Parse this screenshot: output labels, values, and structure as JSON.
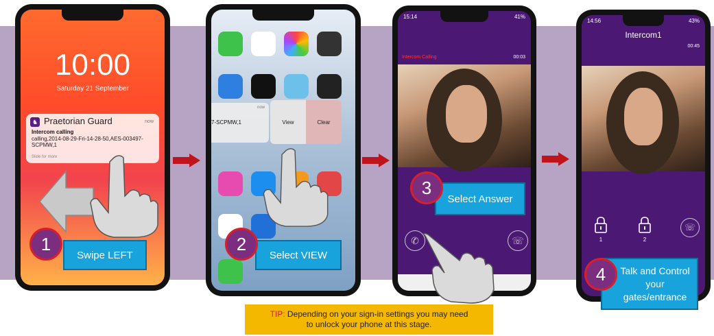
{
  "phone1": {
    "time": "10:00",
    "date": "Saturday 21 September",
    "notification": {
      "app": "Praetorian Guard",
      "when": "now",
      "title": "Intercom calling",
      "body": "calling,2014-08-29-Fri-14-28-50,AES-003497-SCPMW,1",
      "hint": "Slide for more"
    }
  },
  "phone2": {
    "when": "now",
    "fragment": "7-SCPMW,1",
    "view_label": "View",
    "clear_label": "Clear"
  },
  "phone3": {
    "status_time": "15:14",
    "status_right": "41%",
    "calling_label": "Intercom Calling",
    "timer": "00:03"
  },
  "phone4": {
    "status_time": "14:56",
    "status_right": "43%",
    "title": "Intercom1",
    "timer": "00:45",
    "lock1": "1",
    "lock2": "2"
  },
  "steps": [
    {
      "number": "1",
      "label": "Swipe LEFT"
    },
    {
      "number": "2",
      "label": "Select VIEW"
    },
    {
      "number": "3",
      "label": "Select Answer"
    },
    {
      "number": "4",
      "label": "Talk and Control your gates/entrance"
    }
  ],
  "tip": {
    "prefix": "TIP:",
    "text": " Depending on your sign-in settings you may need to unlock your phone at this stage."
  },
  "colors": {
    "band": "#b7a3c4",
    "badge_fill": "#7b2d80",
    "badge_ring": "#d81e2a",
    "callout": "#19a3dd",
    "arrow": "#c0141c",
    "app_purple": "#5a1e86",
    "tip_bg": "#f5b800"
  }
}
